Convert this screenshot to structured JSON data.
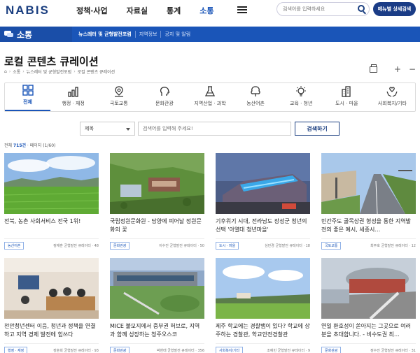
{
  "header": {
    "logo": "NABIS",
    "nav": [
      "정책·사업",
      "자료실",
      "통계",
      "소통"
    ],
    "active_nav": 3,
    "search_placeholder": "검색어를 입력하세요",
    "menu_search_label": "메뉴별 상세검색"
  },
  "section": {
    "title": "소통",
    "subnav": [
      "뉴스레터 및 균형발전포럼",
      "지역정보",
      "공지 및 알림"
    ]
  },
  "page": {
    "title": "로컬 콘텐츠 큐레이션",
    "breadcrumb": [
      "소통",
      "뉴스레터 및 균형발전포럼",
      "로컬 콘텐츠 큐레이션"
    ]
  },
  "categories": [
    {
      "label": "전체",
      "icon": "grid-icon"
    },
    {
      "label": "행정 · 재정",
      "icon": "bar-chart-icon"
    },
    {
      "label": "국토교통",
      "icon": "map-pin-icon"
    },
    {
      "label": "문화관광",
      "icon": "head-icon"
    },
    {
      "label": "지역산업 · 과학",
      "icon": "flask-icon"
    },
    {
      "label": "농산어촌",
      "icon": "tree-icon"
    },
    {
      "label": "교육 · 청년",
      "icon": "bulb-icon"
    },
    {
      "label": "도시 · 마을",
      "icon": "buildings-icon"
    },
    {
      "label": "사회복지/기타",
      "icon": "hands-heart-icon"
    }
  ],
  "filter": {
    "select_value": "제목",
    "input_placeholder": "검색어를 입력해 주세요!",
    "search_button": "검색하기"
  },
  "count": {
    "prefix": "전체",
    "total": "715건",
    "page_label": "페이지 (1/60)"
  },
  "cards": [
    {
      "title": "전북, 농촌 사회서비스 전국 1위!",
      "tag": "농산어촌",
      "author": "정재훈 균형발전 큐레이터 · 48"
    },
    {
      "title": "국립정원문화원 - 담양에 피어날 정원문화의 꽃",
      "tag": "문화관광",
      "author": "이수진 균형발전 큐레이터 · 50"
    },
    {
      "title": "기후위기 시대, 전라남도 장성군 청년의 선택 '아열대 청년마을'",
      "tag": "도시 · 마을",
      "author": "심민경 균형발전 큐레이터 · 18"
    },
    {
      "title": "민간주도 골목상권 형성을 통한 지역발전의 좋은 예시, 세종시…",
      "tag": "국토교통",
      "author": "최주호 균형발전 큐레이터 · 12"
    },
    {
      "title": "천안청년센터 이음, 청년과 정책을 연결하고 지역 경제 발전에 힘쓰다",
      "tag": "행정 · 재정",
      "author": "장춘희 균형발전 큐레이터 · 93"
    },
    {
      "title": "MICE 불모지에서 중부권 허브로, 지역과 함께 성장하는 청주오스코",
      "tag": "문화관광",
      "author": "박현태 균형발전 큐레이터 · 356"
    },
    {
      "title": "제주 학교에는 경찰뱀이 있다? 학교에 상주하는 경찰관, 학교안전경찰관",
      "tag": "사회복지/기타",
      "author": "조예빈 균형발전 큐레이터 · 9"
    },
    {
      "title": "연일 환호성이 쏟아지는 그곳으로 여러분을 초대합니다. - 비수도권 최…",
      "tag": "문화관광",
      "author": "정수진 균형발전 큐레이터 · 31"
    }
  ]
}
